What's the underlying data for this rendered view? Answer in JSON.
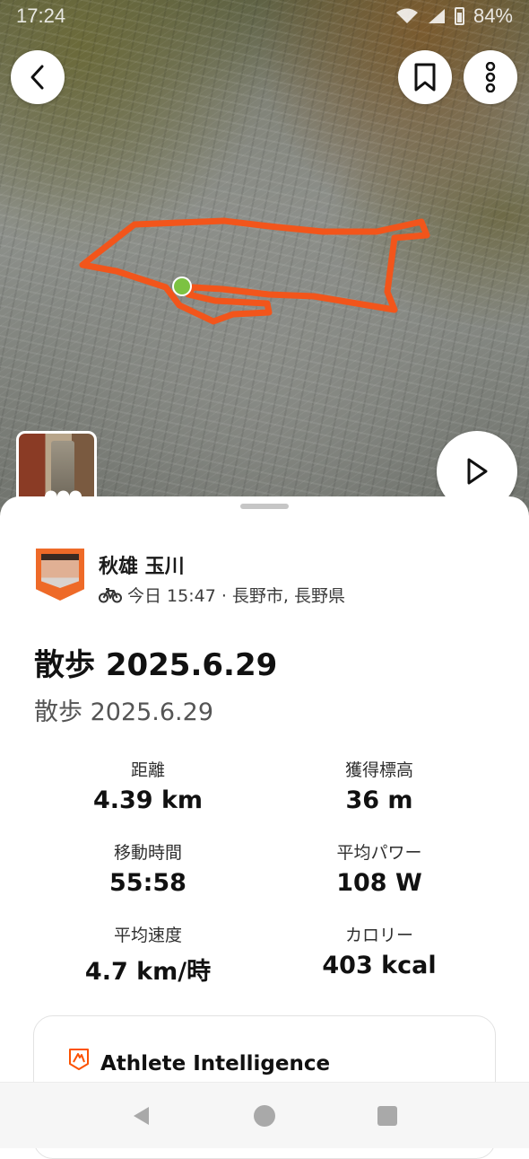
{
  "status_bar": {
    "time": "17:24",
    "battery": "84%"
  },
  "map": {
    "route_color": "#f2551b",
    "start_marker_color": "#7cc242"
  },
  "activity": {
    "athlete_name": "秋雄 玉川",
    "meta": "今日 15:47 · 長野市, 長野県",
    "title": "散歩 2025.6.29",
    "subtitle": "散歩 2025.6.29"
  },
  "stats": [
    {
      "label": "距離",
      "value": "4.39 km"
    },
    {
      "label": "獲得標高",
      "value": "36 m"
    },
    {
      "label": "移動時間",
      "value": "55:58"
    },
    {
      "label": "平均パワー",
      "value": "108 W"
    },
    {
      "label": "平均速度",
      "value": "4.7 km/時"
    },
    {
      "label": "カロリー",
      "value": "403 kcal"
    }
  ],
  "ai_card": {
    "title": "Athlete Intelligence"
  },
  "colors": {
    "accent": "#fc5200"
  }
}
